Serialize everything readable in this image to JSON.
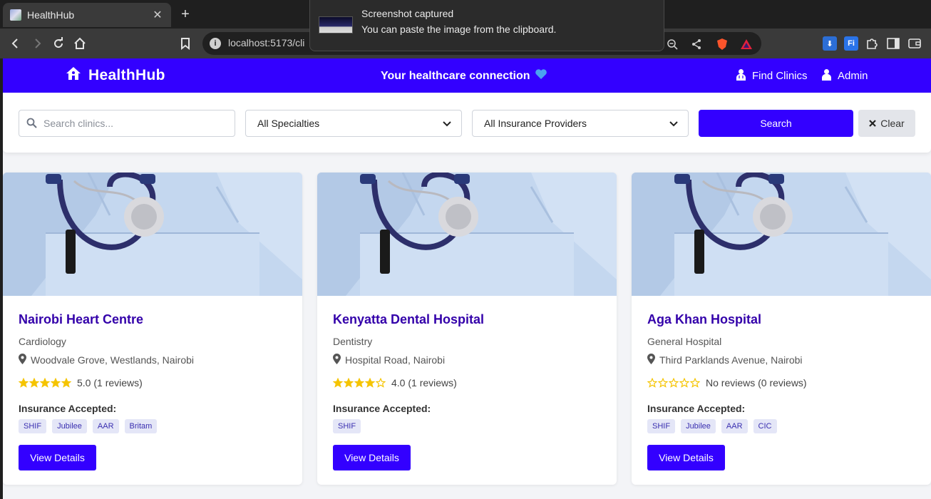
{
  "browser": {
    "tab_title": "HealthHub",
    "new_tab_label": "+",
    "url": "localhost:5173/cli",
    "notification": {
      "title": "Screenshot captured",
      "message": "You can paste the image from the clipboard."
    }
  },
  "navbar": {
    "brand": "HealthHub",
    "tagline": "Your healthcare connection",
    "links": [
      {
        "label": "Find Clinics",
        "icon": "doctor-icon"
      },
      {
        "label": "Admin",
        "icon": "user-icon"
      }
    ]
  },
  "filters": {
    "search_placeholder": "Search clinics...",
    "specialty_selected": "All Specialties",
    "insurance_selected": "All Insurance Providers",
    "search_button": "Search",
    "clear_button": "Clear"
  },
  "clinics": [
    {
      "name": "Nairobi Heart Centre",
      "specialty": "Cardiology",
      "address": "Woodvale Grove, Westlands, Nairobi",
      "stars": 5,
      "rating_text": "5.0 (1 reviews)",
      "insurance_label": "Insurance Accepted:",
      "insurance": [
        "SHIF",
        "Jubilee",
        "AAR",
        "Britam"
      ],
      "button": "View Details"
    },
    {
      "name": "Kenyatta Dental Hospital",
      "specialty": "Dentistry",
      "address": "Hospital Road, Nairobi",
      "stars": 4,
      "rating_text": "4.0 (1 reviews)",
      "insurance_label": "Insurance Accepted:",
      "insurance": [
        "SHIF"
      ],
      "button": "View Details"
    },
    {
      "name": "Aga Khan Hospital",
      "specialty": "General Hospital",
      "address": "Third Parklands Avenue, Nairobi",
      "stars": 0,
      "rating_text": "No reviews (0 reviews)",
      "insurance_label": "Insurance Accepted:",
      "insurance": [
        "SHIF",
        "Jubilee",
        "AAR",
        "CIC"
      ],
      "button": "View Details"
    }
  ],
  "colors": {
    "primary": "#3300ff",
    "star": "#f5c400",
    "title": "#3300aa"
  }
}
